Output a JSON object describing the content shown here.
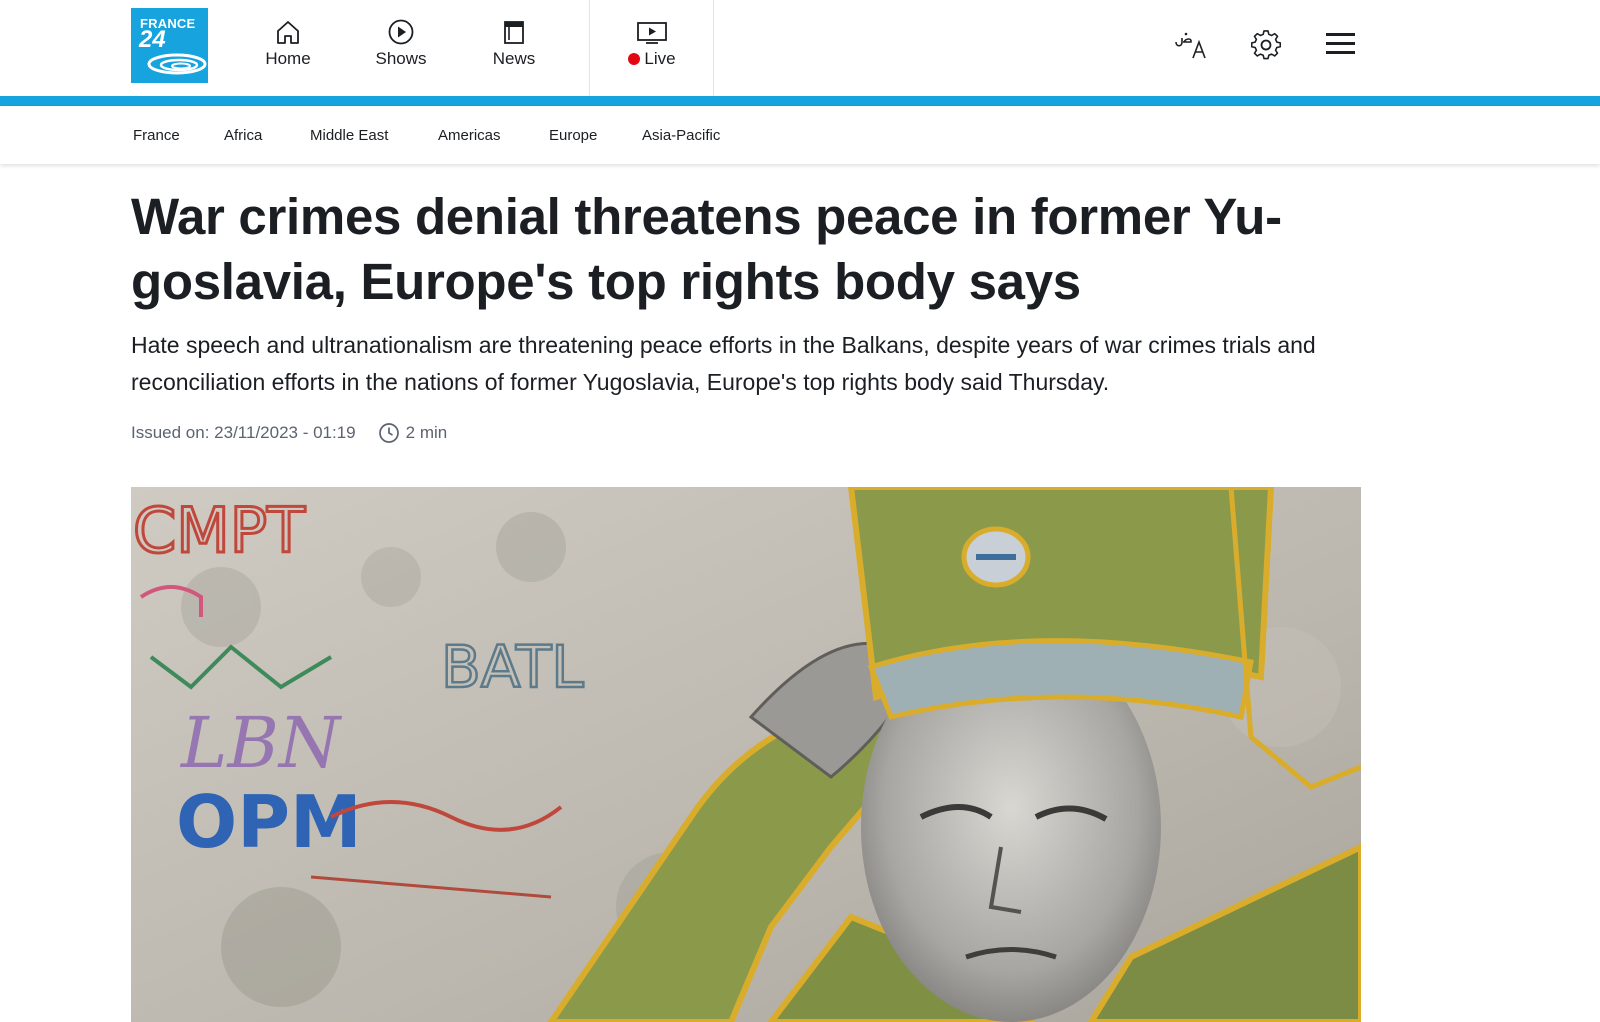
{
  "brand": {
    "logo_line1": "FRANCE",
    "logo_line2": "24",
    "color": "#17a3dd"
  },
  "topnav": {
    "home": "Home",
    "shows": "Shows",
    "news": "News",
    "live": "Live"
  },
  "subnav": [
    "France",
    "Africa",
    "Middle East",
    "Americas",
    "Europe",
    "Asia-Pacific"
  ],
  "article": {
    "headline": "War crimes denial threatens peace in former Yu-goslavia, Europe's top rights body says",
    "lede": "Hate speech and ultranationalism are threatening peace efforts in the Balkans, despite years of war crimes trials and reconciliation efforts in the nations of former Yugoslavia, Europe's top rights body said Thursday.",
    "issued": "Issued on: 23/11/2023 - 01:19",
    "read_time": "2 min"
  },
  "hero_graffiti": {
    "text1": "CMPT",
    "text2": "BATL",
    "text3": "OPM",
    "text4": "LBN"
  },
  "colors": {
    "live": "#e30613",
    "accent": "#17a3dd",
    "text": "#1b1e23",
    "muted": "#5c6370"
  }
}
